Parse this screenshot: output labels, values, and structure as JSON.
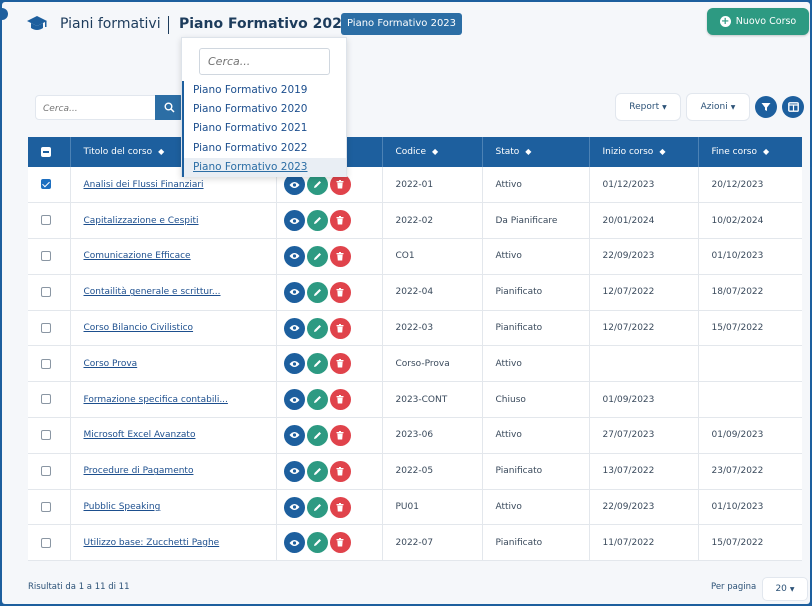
{
  "header": {
    "app_title": "Piani formativi",
    "selected_plan": "Piano Formativo 2023",
    "plan_badge": "Piano Formativo 2023",
    "new_button": "Nuovo Corso"
  },
  "dropdown": {
    "search_placeholder": "Cerca...",
    "items": [
      {
        "label": "Piano Formativo 2019"
      },
      {
        "label": "Piano Formativo 2020"
      },
      {
        "label": "Piano Formativo 2021"
      },
      {
        "label": "Piano Formativo 2022"
      },
      {
        "label": "Piano Formativo 2023",
        "selected": true
      }
    ]
  },
  "toolbar": {
    "search_placeholder": "Cerca...",
    "report_label": "Report",
    "actions_label": "Azioni"
  },
  "table": {
    "columns": [
      "Titolo del corso",
      "Codice",
      "Stato",
      "Inizio corso",
      "Fine corso"
    ],
    "rows": [
      {
        "checked": true,
        "title": "Analisi dei Flussi Finanziari",
        "code": "2022-01",
        "status": "Attivo",
        "start": "01/12/2023",
        "end": "20/12/2023"
      },
      {
        "checked": false,
        "title": "Capitalizzazione e Cespiti",
        "code": "2022-02",
        "status": "Da Pianificare",
        "start": "20/01/2024",
        "end": "10/02/2024"
      },
      {
        "checked": false,
        "title": "Comunicazione Efficace",
        "code": "CO1",
        "status": "Attivo",
        "start": "22/09/2023",
        "end": "01/10/2023"
      },
      {
        "checked": false,
        "title": "Contailità generale e scrittur...",
        "code": "2022-04",
        "status": "Pianificato",
        "start": "12/07/2022",
        "end": "18/07/2022"
      },
      {
        "checked": false,
        "title": "Corso Bilancio Civilistico",
        "code": "2022-03",
        "status": "Pianificato",
        "start": "12/07/2022",
        "end": "15/07/2022"
      },
      {
        "checked": false,
        "title": "Corso Prova",
        "code": "Corso-Prova",
        "status": "Attivo",
        "start": "",
        "end": ""
      },
      {
        "checked": false,
        "title": "Formazione specifica contabili...",
        "code": "2023-CONT",
        "status": "Chiuso",
        "start": "01/09/2023",
        "end": ""
      },
      {
        "checked": false,
        "title": "Microsoft Excel Avanzato",
        "code": "2023-06",
        "status": "Attivo",
        "start": "27/07/2023",
        "end": "01/09/2023"
      },
      {
        "checked": false,
        "title": "Procedure di Pagamento",
        "code": "2022-05",
        "status": "Pianificato",
        "start": "13/07/2022",
        "end": "23/07/2022"
      },
      {
        "checked": false,
        "title": "Pubblic Speaking",
        "code": "PU01",
        "status": "Attivo",
        "start": "22/09/2023",
        "end": "01/10/2023"
      },
      {
        "checked": false,
        "title": "Utilizzo base: Zucchetti Paghe",
        "code": "2022-07",
        "status": "Pianificato",
        "start": "11/07/2022",
        "end": "15/07/2022"
      }
    ]
  },
  "footer": {
    "results_text": "Risultati da 1 a 11 di 11",
    "per_page_label": "Per pagina",
    "per_page_value": "20"
  },
  "colors": {
    "primary": "#1d5f9e",
    "accent_green": "#2d9a82",
    "danger": "#e0434b"
  }
}
